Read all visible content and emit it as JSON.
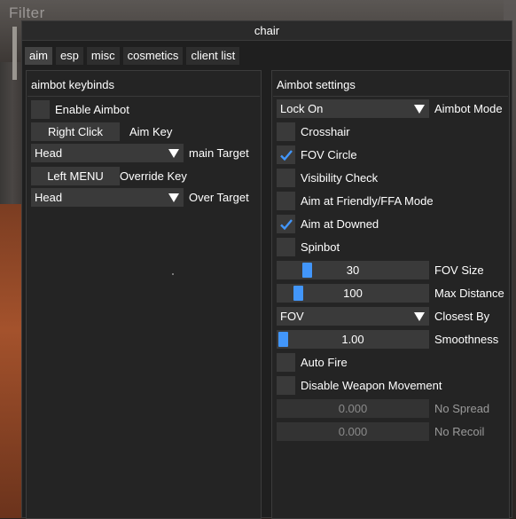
{
  "background": {
    "filter_label": "Filter"
  },
  "window": {
    "title": "chair"
  },
  "tabs": [
    {
      "label": "aim",
      "active": true
    },
    {
      "label": "esp",
      "active": false
    },
    {
      "label": "misc",
      "active": false
    },
    {
      "label": "cosmetics",
      "active": false
    },
    {
      "label": "client list",
      "active": false
    }
  ],
  "left_panel": {
    "title": "aimbot keybinds",
    "enable_aimbot": {
      "label": "Enable Aimbot",
      "checked": false
    },
    "aim_key": {
      "button": "Right Click",
      "label": "Aim Key"
    },
    "main_target": {
      "value": "Head",
      "label": "main Target"
    },
    "override_key": {
      "button": "Left MENU",
      "label": "Override Key"
    },
    "over_target": {
      "value": "Head",
      "label": "Over Target"
    }
  },
  "right_panel": {
    "title": "Aimbot settings",
    "aimbot_mode": {
      "value": "Lock On",
      "label": "Aimbot Mode"
    },
    "crosshair": {
      "label": "Crosshair",
      "checked": false
    },
    "fov_circle": {
      "label": "FOV Circle",
      "checked": true
    },
    "visibility_check": {
      "label": "Visibility Check",
      "checked": false
    },
    "aim_friendly": {
      "label": "Aim at Friendly/FFA Mode",
      "checked": false
    },
    "aim_downed": {
      "label": "Aim at Downed",
      "checked": true
    },
    "spinbot": {
      "label": "Spinbot",
      "checked": false
    },
    "fov_size": {
      "value": "30",
      "label": "FOV Size",
      "fill": 0.17
    },
    "max_distance": {
      "value": "100",
      "label": "Max Distance",
      "fill": 0.11
    },
    "closest_by": {
      "value": "FOV",
      "label": "Closest By"
    },
    "smoothness": {
      "value": "1.00",
      "label": "Smoothness",
      "fill": 0.0
    },
    "auto_fire": {
      "label": "Auto Fire",
      "checked": false
    },
    "disable_weapon_movement": {
      "label": "Disable Weapon Movement",
      "checked": false
    },
    "no_spread": {
      "value": "0.000",
      "label": "No Spread"
    },
    "no_recoil": {
      "value": "0.000",
      "label": "No Recoil"
    }
  },
  "colors": {
    "accent": "#4296fa",
    "frame": "#3a3a3a",
    "window_bg": "#1f1f1f"
  }
}
